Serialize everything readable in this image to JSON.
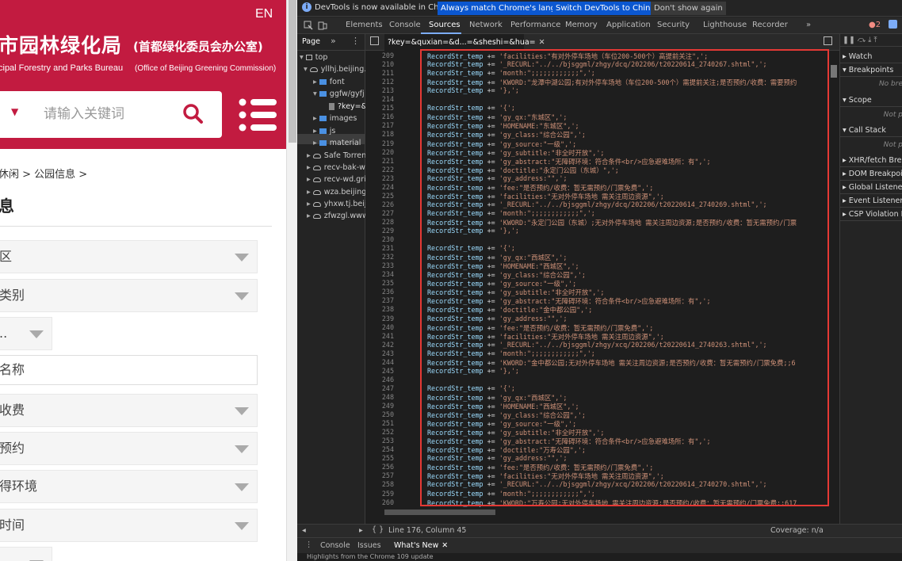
{
  "website": {
    "lang_toggle": "EN",
    "title": "市园林绿化局",
    "title_suffix": "(首都绿化委员会办公室)",
    "subtitle_en": "cipal Forestry and Parks Bureau",
    "subtitle_en_suffix": "(Office of Beijing Greening Commission)",
    "search_placeholder": "请输入关键词",
    "breadcrumb": "休闲 > 公园信息 >",
    "page_title": "息",
    "filters": [
      {
        "label": "区"
      },
      {
        "label": "类别"
      },
      {
        "label": ".."
      },
      {
        "label": "名称"
      },
      {
        "label": "收费"
      },
      {
        "label": "预约"
      },
      {
        "label": "得环境"
      },
      {
        "label": "时间"
      },
      {
        "label": ""
      }
    ]
  },
  "devtools": {
    "info_bar": {
      "message": "DevTools is now available in Chinese!",
      "btn_match": "Always match Chrome's language",
      "btn_switch": "Switch DevTools to Chinese",
      "btn_dismiss": "Don't show again"
    },
    "tabs": [
      "Elements",
      "Console",
      "Sources",
      "Network",
      "Performance",
      "Memory",
      "Application",
      "Security",
      "Lighthouse",
      "Recorder"
    ],
    "active_tab": "Sources",
    "error_count": "2",
    "nav_tab": "Page",
    "file_tab": "?key=&quxian=&d...=&sheshi=&hua=",
    "tree": [
      {
        "label": "top",
        "kind": "frame",
        "indent": 0
      },
      {
        "label": "yllhj.beijing.",
        "kind": "cloud",
        "indent": 1
      },
      {
        "label": "font",
        "kind": "folder",
        "indent": 2
      },
      {
        "label": "ggfw/gyfj",
        "kind": "folder",
        "indent": 2
      },
      {
        "label": "?key=&",
        "kind": "file",
        "indent": 3
      },
      {
        "label": "images",
        "kind": "folder",
        "indent": 2
      },
      {
        "label": "js",
        "kind": "folder",
        "indent": 2
      },
      {
        "label": "material",
        "kind": "folder",
        "indent": 2
      },
      {
        "label": "Safe Torrent",
        "kind": "cloud",
        "indent": 0
      },
      {
        "label": "recv-bak-we",
        "kind": "cloud",
        "indent": 0
      },
      {
        "label": "recv-wd.gric",
        "kind": "cloud",
        "indent": 0
      },
      {
        "label": "wza.beijing.",
        "kind": "cloud",
        "indent": 0
      },
      {
        "label": "yhxw.tj.beiji",
        "kind": "cloud",
        "indent": 0
      },
      {
        "label": "zfwzgl.www",
        "kind": "cloud",
        "indent": 0
      }
    ],
    "code_lines": [
      {
        "n": "209",
        "c": "RecordStr_temp += 'facilities:\"有对外停车场地（车位200-500个）高提前关注\",';"
      },
      {
        "n": "210",
        "c": "RecordStr_temp += '_RECURL:\"../../bjsggml/zhgy/dcq/202206/t20220614_2740267.shtml\",';"
      },
      {
        "n": "211",
        "c": "RecordStr_temp += 'month:\";;;;;;;;;;;;\",';"
      },
      {
        "n": "212",
        "c": "RecordStr_temp += 'KWORD:\"龙潭中湖公园;有对外停车场地（车位200-500个）需提前关注;是否预约/收费：需要预约"
      },
      {
        "n": "213",
        "c": "RecordStr_temp += '},';"
      },
      {
        "n": "214",
        "c": ""
      },
      {
        "n": "215",
        "c": "RecordStr_temp += '{';"
      },
      {
        "n": "216",
        "c": "RecordStr_temp += 'gy_qx:\"东城区\",';"
      },
      {
        "n": "217",
        "c": "RecordStr_temp += 'HOMENAME:\"东城区\",';"
      },
      {
        "n": "218",
        "c": "RecordStr_temp += 'gy_class:\"综合公园\",';"
      },
      {
        "n": "219",
        "c": "RecordStr_temp += 'gy_source:\"一级\",';"
      },
      {
        "n": "220",
        "c": "RecordStr_temp += 'gy_subtitle:\"非全时开放\",';"
      },
      {
        "n": "221",
        "c": "RecordStr_temp += 'gy_abstract:\"无障碍环境：符合条件<br/>应急避难场所：有\",';"
      },
      {
        "n": "222",
        "c": "RecordStr_temp += 'doctitle:\"永定门公园（东城）\",';"
      },
      {
        "n": "223",
        "c": "RecordStr_temp += 'gy_address:\"\",';"
      },
      {
        "n": "224",
        "c": "RecordStr_temp += 'fee:\"是否预约/收费：暂无需预约/门票免费\",';"
      },
      {
        "n": "225",
        "c": "RecordStr_temp += 'facilities:\"无对外停车场地 需关注周边资源\",';"
      },
      {
        "n": "226",
        "c": "RecordStr_temp += '_RECURL:\"../../bjsggml/zhgy/dcq/202206/t20220614_2740269.shtml\",';"
      },
      {
        "n": "227",
        "c": "RecordStr_temp += 'month:\";;;;;;;;;;;;\",';"
      },
      {
        "n": "228",
        "c": "RecordStr_temp += 'KWORD:\"永定门公园（东城）;无对外停车场地 需关注周边资源;是否预约/收费：暂无需预约/门票"
      },
      {
        "n": "229",
        "c": "RecordStr_temp += '},';"
      },
      {
        "n": "230",
        "c": ""
      },
      {
        "n": "231",
        "c": "RecordStr_temp += '{';"
      },
      {
        "n": "232",
        "c": "RecordStr_temp += 'gy_qx:\"西城区\",';"
      },
      {
        "n": "233",
        "c": "RecordStr_temp += 'HOMENAME:\"西城区\",';"
      },
      {
        "n": "234",
        "c": "RecordStr_temp += 'gy_class:\"综合公园\",';"
      },
      {
        "n": "235",
        "c": "RecordStr_temp += 'gy_source:\"一级\",';"
      },
      {
        "n": "236",
        "c": "RecordStr_temp += 'gy_subtitle:\"非全时开放\",';"
      },
      {
        "n": "237",
        "c": "RecordStr_temp += 'gy_abstract:\"无障碍环境：符合条件<br/>应急避难场所：有\",';"
      },
      {
        "n": "238",
        "c": "RecordStr_temp += 'doctitle:\"金中都公园\",';"
      },
      {
        "n": "239",
        "c": "RecordStr_temp += 'gy_address:\"\",';"
      },
      {
        "n": "240",
        "c": "RecordStr_temp += 'fee:\"是否预约/收费：暂无需预约/门票免费\",';"
      },
      {
        "n": "241",
        "c": "RecordStr_temp += 'facilities:\"无对外停车场地 需关注周边资源\",';"
      },
      {
        "n": "242",
        "c": "RecordStr_temp += '_RECURL:\"../../bjsggml/zhgy/xcq/202206/t20220614_2740263.shtml\",';"
      },
      {
        "n": "243",
        "c": "RecordStr_temp += 'month:\";;;;;;;;;;;;\",';"
      },
      {
        "n": "244",
        "c": "RecordStr_temp += 'KWORD:\"金中都公园;无对外停车场地 需关注周边资源;是否预约/收费：暂无需预约/门票免费;;6"
      },
      {
        "n": "245",
        "c": "RecordStr_temp += '},';"
      },
      {
        "n": "246",
        "c": ""
      },
      {
        "n": "247",
        "c": "RecordStr_temp += '{';"
      },
      {
        "n": "248",
        "c": "RecordStr_temp += 'gy_qx:\"西城区\",';"
      },
      {
        "n": "249",
        "c": "RecordStr_temp += 'HOMENAME:\"西城区\",';"
      },
      {
        "n": "250",
        "c": "RecordStr_temp += 'gy_class:\"综合公园\",';"
      },
      {
        "n": "251",
        "c": "RecordStr_temp += 'gy_source:\"一级\",';"
      },
      {
        "n": "252",
        "c": "RecordStr_temp += 'gy_subtitle:\"非全时开放\",';"
      },
      {
        "n": "253",
        "c": "RecordStr_temp += 'gy_abstract:\"无障碍环境：符合条件<br/>应急避难场所：有\",';"
      },
      {
        "n": "254",
        "c": "RecordStr_temp += 'doctitle:\"万寿公园\",';"
      },
      {
        "n": "255",
        "c": "RecordStr_temp += 'gy_address:\"\",';"
      },
      {
        "n": "256",
        "c": "RecordStr_temp += 'fee:\"是否预约/收费：暂无需预约/门票免费\",';"
      },
      {
        "n": "257",
        "c": "RecordStr_temp += 'facilities:\"无对外停车场地 需关注周边资源\",';"
      },
      {
        "n": "258",
        "c": "RecordStr_temp += '_RECURL:\"../../bjsggml/zhgy/xcq/202206/t20220614_2740270.shtml\",';"
      },
      {
        "n": "259",
        "c": "RecordStr_temp += 'month:\";;;;;;;;;;;;\",';"
      },
      {
        "n": "260",
        "c": "RecordStr_temp += 'KWORD:\"万寿公园;无对外停车场地 需关注周边资源;是否预约/收费：暂无需预约/门票免费;;617"
      },
      {
        "n": "261",
        "c": "RecordStr_temp += '},';"
      }
    ],
    "status_left": "Line 176, Column 45",
    "status_right": "Coverage: n/a",
    "drawer_tabs": [
      "Console",
      "Issues",
      "What's New"
    ],
    "drawer_bottom": "Highlights from the Chrome 109 update",
    "right_panel": [
      {
        "label": "Watch",
        "empty": ""
      },
      {
        "label": "Breakpoints",
        "empty": "No bre"
      },
      {
        "label": "Scope",
        "empty": "Not p"
      },
      {
        "label": "Call Stack",
        "empty": "Not p"
      },
      {
        "label": "XHR/fetch Break",
        "empty": ""
      },
      {
        "label": "DOM Breakpoint",
        "empty": ""
      },
      {
        "label": "Global Listeners",
        "empty": ""
      },
      {
        "label": "Event Listener Br",
        "empty": ""
      },
      {
        "label": "CSP Violation Br",
        "empty": ""
      }
    ]
  },
  "colors": {
    "brand_red": "#c21b40",
    "devtools_bg": "#242424",
    "highlight_box": "#e53935",
    "accent_blue": "#0b57d0"
  }
}
